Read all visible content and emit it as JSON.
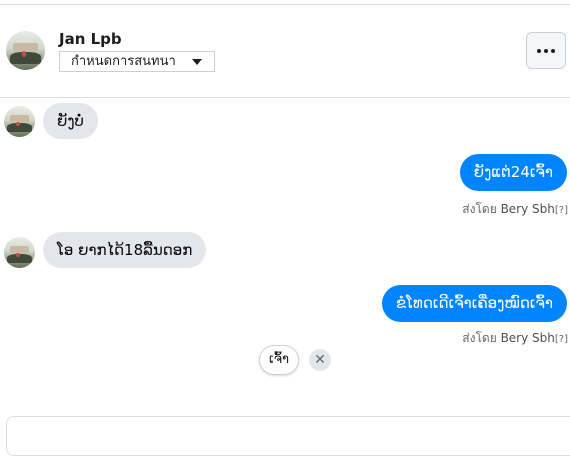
{
  "header": {
    "contact_name": "Jan Lpb",
    "options_select": "กำหนดการสนทนา",
    "more_label": "..."
  },
  "messages": [
    {
      "direction": "incoming",
      "text": "ຍັງບໍ່"
    },
    {
      "direction": "outgoing",
      "text": "ຍັງແຕ່24ເຈົ້າ",
      "sent_by_prefix": "ส่งโดย",
      "sent_by_name": "Bery Sbh",
      "sent_by_help": "[?]"
    },
    {
      "direction": "incoming",
      "text": "ໂອ ຍາກໄດ້18ລື້ນດອກ"
    },
    {
      "direction": "outgoing",
      "text": "ຂໍໂທດເດີເຈົ້າເຄື່ອງໝົດເຈົ້າ",
      "sent_by_prefix": "ส่งโดย",
      "sent_by_name": "Bery Sbh",
      "sent_by_help": "[?]"
    }
  ],
  "quick_reply": {
    "label": "ເຈົ້າ",
    "dismiss": "✕"
  },
  "colors": {
    "outgoing_bubble": "#0084ff",
    "incoming_bubble": "#e4e6eb",
    "text_secondary": "#65676b"
  },
  "icons": {
    "more": "ellipsis-icon",
    "dropdown": "caret-down-icon",
    "dismiss": "close-icon"
  }
}
